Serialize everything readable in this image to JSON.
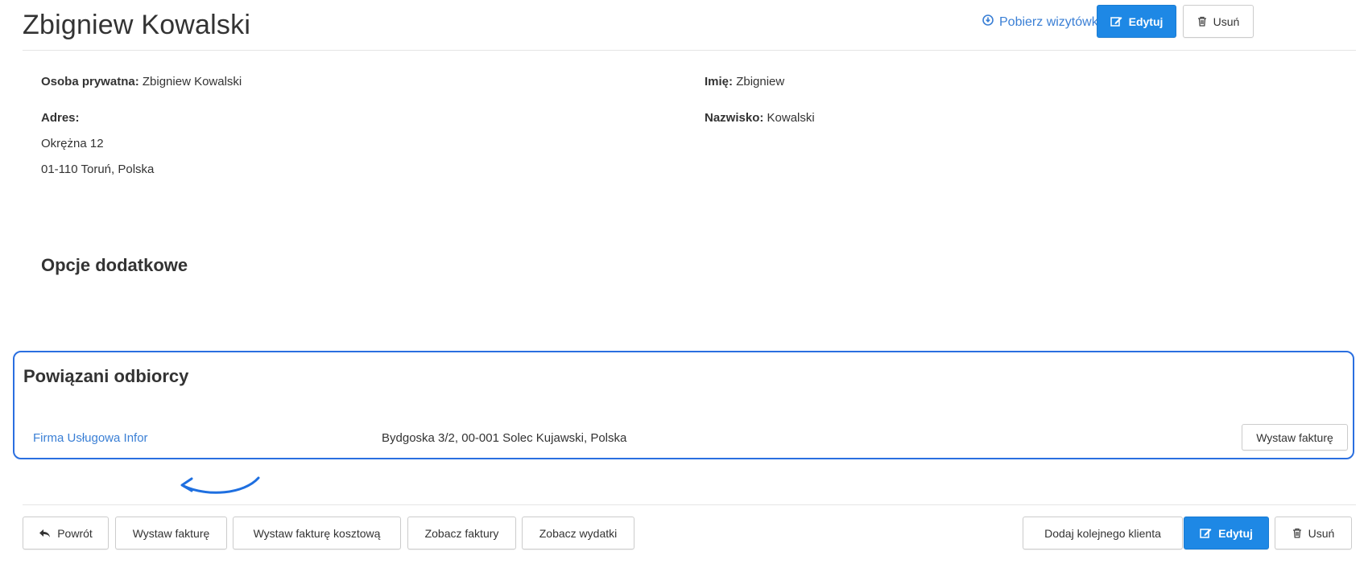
{
  "header": {
    "title": "Zbigniew Kowalski",
    "vcard_link": "Pobierz wizytówkę vCard",
    "edit_label": "Edytuj",
    "delete_label": "Usuń"
  },
  "details": {
    "private_person_label": "Osoba prywatna:",
    "private_person_value": "Zbigniew Kowalski",
    "address_label": "Adres:",
    "address_line1": "Okrężna 12",
    "address_line2": "01-110 Toruń, Polska",
    "first_name_label": "Imię:",
    "first_name_value": "Zbigniew",
    "last_name_label": "Nazwisko:",
    "last_name_value": "Kowalski"
  },
  "additional_options": {
    "title": "Opcje dodatkowe"
  },
  "related": {
    "title": "Powiązani odbiorcy",
    "recipients": [
      {
        "name": "Firma Usługowa Infor",
        "address": "Bydgoska 3/2, 00-001 Solec Kujawski, Polska",
        "action_label": "Wystaw fakturę"
      }
    ]
  },
  "footer": {
    "back_label": "Powrót",
    "issue_invoice_label": "Wystaw fakturę",
    "issue_cost_invoice_label": "Wystaw fakturę kosztową",
    "view_invoices_label": "Zobacz faktury",
    "view_expenses_label": "Zobacz wydatki",
    "add_client_label": "Dodaj kolejnego klienta",
    "edit_label": "Edytuj",
    "delete_label": "Usuń"
  },
  "colors": {
    "primary": "#1e88e5",
    "link": "#3a7fd5",
    "highlight_border": "#2a6fe0"
  },
  "icons": {
    "vcard": "download-circle-icon",
    "edit": "edit-icon",
    "delete": "trash-icon",
    "back": "reply-arrow-icon",
    "annotation": "curved-arrow-icon"
  }
}
